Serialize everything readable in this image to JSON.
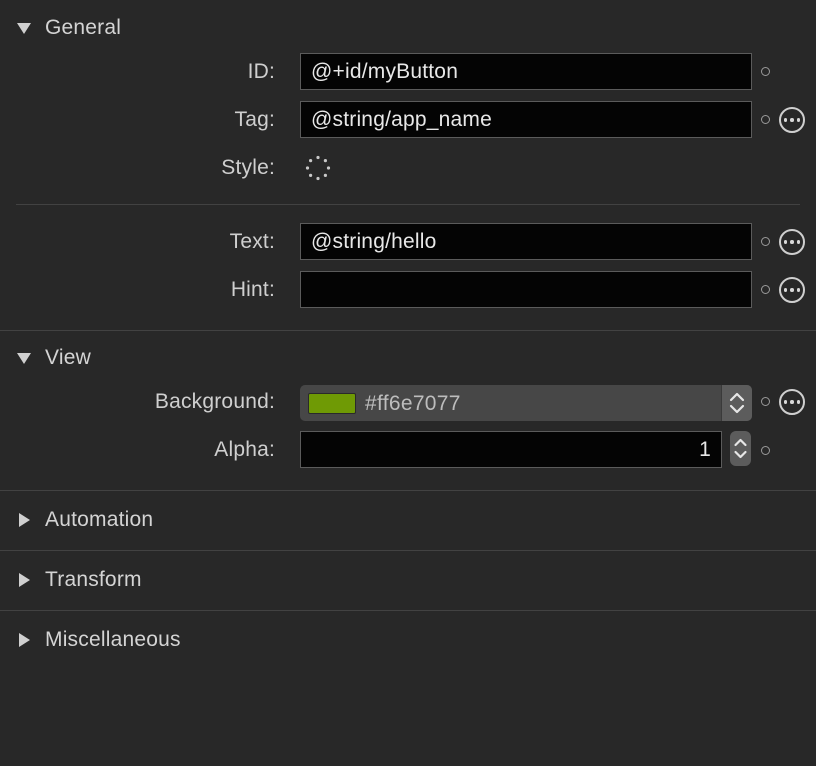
{
  "sections": {
    "general": {
      "title": "General",
      "expanded": true
    },
    "view": {
      "title": "View",
      "expanded": true
    },
    "automation": {
      "title": "Automation",
      "expanded": false
    },
    "transform": {
      "title": "Transform",
      "expanded": false
    },
    "miscellaneous": {
      "title": "Miscellaneous",
      "expanded": false
    }
  },
  "general": {
    "id": {
      "label": "ID:",
      "value": "@+id/myButton"
    },
    "tag": {
      "label": "Tag:",
      "value": "@string/app_name"
    },
    "style": {
      "label": "Style:"
    },
    "text": {
      "label": "Text:",
      "value": "@string/hello"
    },
    "hint": {
      "label": "Hint:",
      "value": ""
    }
  },
  "view": {
    "background": {
      "label": "Background:",
      "value": "#ff6e7077",
      "swatch_color": "#6f9a05"
    },
    "alpha": {
      "label": "Alpha:",
      "value": "1"
    }
  },
  "icons": {
    "expanded": "triangle-down-icon",
    "collapsed": "triangle-right-icon",
    "attribute": "circle-dot-icon",
    "more": "more-options-icon",
    "stepper": "up-down-stepper-icon",
    "loading": "spinner-icon"
  }
}
